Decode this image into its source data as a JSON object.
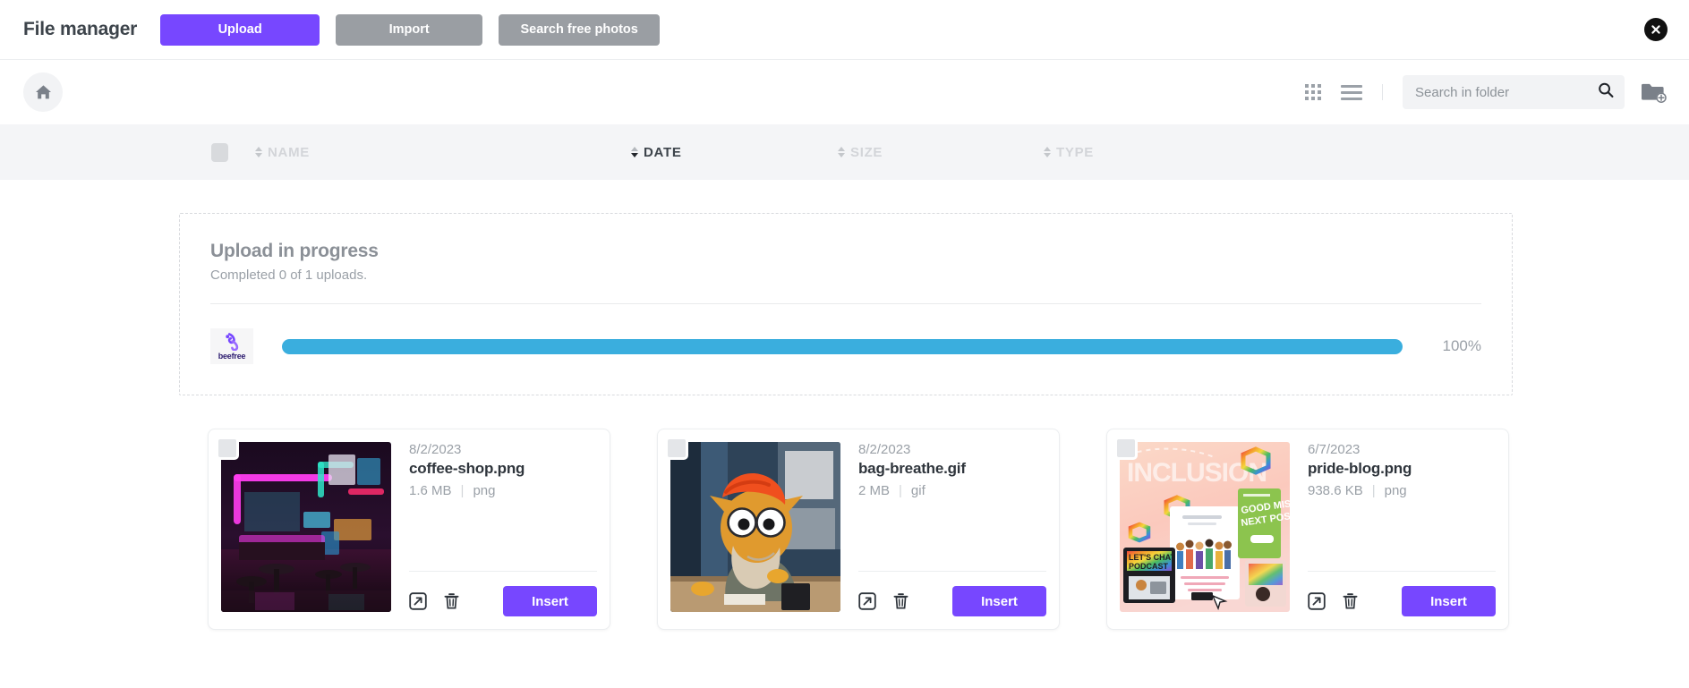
{
  "header": {
    "title": "File manager",
    "upload_label": "Upload",
    "import_label": "Import",
    "search_free_photos_label": "Search free photos",
    "close_icon": "close-circle-icon",
    "primary_color": "#7747ff",
    "secondary_color": "#9a9ea3"
  },
  "toolbar": {
    "home_icon": "home-icon",
    "grid_view_icon": "grid-view-icon",
    "list_view_icon": "list-view-icon",
    "search": {
      "placeholder": "Search in folder",
      "value": "",
      "icon": "search-icon"
    },
    "new_folder_icon": "folder-add-icon"
  },
  "columns": {
    "select_all_checkbox": "select-all-checkbox",
    "items": [
      {
        "label": "NAME",
        "active": false
      },
      {
        "label": "DATE",
        "active": true
      },
      {
        "label": "SIZE",
        "active": false
      },
      {
        "label": "TYPE",
        "active": false
      }
    ]
  },
  "upload": {
    "title": "Upload in progress",
    "subtitle": "Completed 0 of 1 uploads.",
    "logo_text": "beefree",
    "progress_percent": 100,
    "progress_label": "100%",
    "bar_color": "#3aaede"
  },
  "files": [
    {
      "date": "8/2/2023",
      "name": "coffee-shop.png",
      "size": "1.6 MB",
      "type": "png",
      "separator": "|",
      "insert_label": "Insert",
      "expand_icon": "expand-icon",
      "delete_icon": "trash-icon",
      "checkbox": "select-file-checkbox",
      "thumbnail": "neon-coffee-shop-thumbnail"
    },
    {
      "date": "8/2/2023",
      "name": "bag-breathe.gif",
      "size": "2 MB",
      "type": "gif",
      "separator": "|",
      "insert_label": "Insert",
      "expand_icon": "expand-icon",
      "delete_icon": "trash-icon",
      "checkbox": "select-file-checkbox",
      "thumbnail": "puppet-breathing-bag-thumbnail"
    },
    {
      "date": "6/7/2023",
      "name": "pride-blog.png",
      "size": "938.6 KB",
      "type": "png",
      "separator": "|",
      "insert_label": "Insert",
      "expand_icon": "expand-icon",
      "delete_icon": "trash-icon",
      "checkbox": "select-file-checkbox",
      "thumbnail": "pride-inclusion-collage-thumbnail"
    }
  ]
}
